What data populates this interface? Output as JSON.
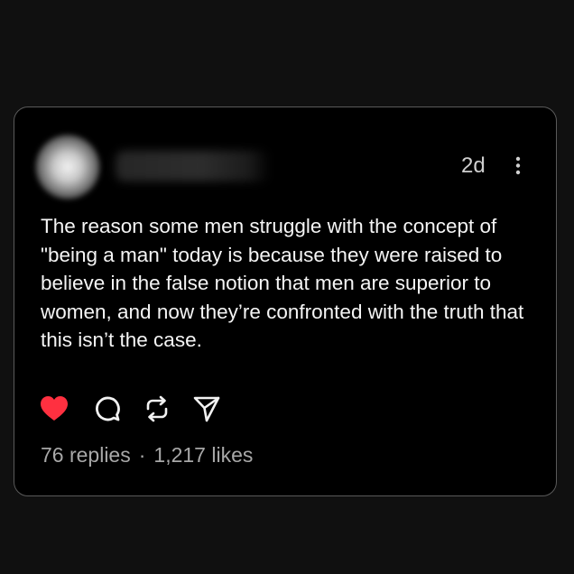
{
  "post": {
    "timestamp": "2d",
    "text": "The reason some men struggle with the concept of \"being a man\" today is because they were raised to believe in the false notion that men are superior to women, and now they’re confronted with the truth that this isn’t the case.",
    "replies": "76 replies",
    "separator": "·",
    "likes": "1,217 likes",
    "liked": true
  },
  "icons": {
    "more": "more-vertical-icon",
    "like": "heart-icon",
    "reply": "comment-icon",
    "repost": "repost-icon",
    "share": "send-icon"
  },
  "colors": {
    "background": "#101010",
    "card": "#000000",
    "card_border": "#5a5a5a",
    "text": "#f5f5f5",
    "muted": "#a8a8a8",
    "like": "#ff3040"
  }
}
